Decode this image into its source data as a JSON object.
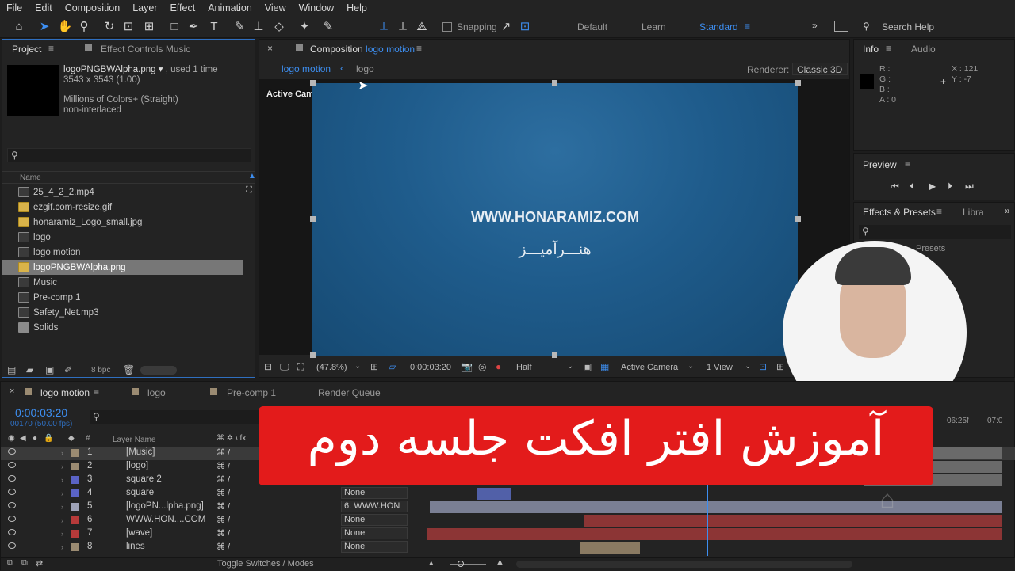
{
  "menu": [
    "File",
    "Edit",
    "Composition",
    "Layer",
    "Effect",
    "Animation",
    "View",
    "Window",
    "Help"
  ],
  "toolbar": {
    "snapping_label": "Snapping",
    "workspaces": [
      "Default",
      "Learn",
      "Standard"
    ],
    "search_placeholder": "Search Help"
  },
  "project": {
    "tab_project": "Project",
    "tab_effect_controls": "Effect Controls Music",
    "file_name": "logoPNGBWAlpha.png",
    "used": ", used 1 time",
    "dims": "3543 x 3543 (1.00)",
    "colors": "Millions of Colors+ (Straight)",
    "interlace": "non-interlaced",
    "col_name": "Name",
    "bpc": "8 bpc",
    "items": [
      {
        "name": "25_4_2_2.mp4",
        "icon": "video-icon"
      },
      {
        "name": "ezgif.com-resize.gif",
        "icon": "image-icon"
      },
      {
        "name": "honaramiz_Logo_small.jpg",
        "icon": "image-icon"
      },
      {
        "name": "logo",
        "icon": "composition-icon"
      },
      {
        "name": "logo motion",
        "icon": "composition-icon"
      },
      {
        "name": "logoPNGBWAlpha.png",
        "icon": "image-icon"
      },
      {
        "name": "Music",
        "icon": "composition-icon"
      },
      {
        "name": "Pre-comp 1",
        "icon": "composition-icon"
      },
      {
        "name": "Safety_Net.mp3",
        "icon": "audio-icon"
      },
      {
        "name": "Solids",
        "icon": "folder-icon"
      }
    ]
  },
  "composition": {
    "title_prefix": "Composition",
    "title_name": "logo motion",
    "crumb1": "logo motion",
    "crumb2": "logo",
    "renderer_label": "Renderer:",
    "renderer_value": "Classic 3D",
    "view_label": "Active Camera",
    "url_text": "WWW.HONARAMIZ.COM",
    "persian_text": "هنـــرآمیـــز",
    "zoom": "(47.8%)",
    "timecode": "0:00:03:20",
    "resolution": "Half",
    "camera": "Active Camera",
    "views": "1 View"
  },
  "info": {
    "tab_info": "Info",
    "tab_audio": "Audio",
    "r": "R :",
    "g": "G :",
    "b": "B :",
    "a": "A : 0",
    "x": "X : 121",
    "y": "Y : -7"
  },
  "preview": {
    "title": "Preview"
  },
  "effects": {
    "title": "Effects & Presets",
    "tab2": "Libra",
    "presets": "Presets"
  },
  "timeline": {
    "tabs": [
      "logo motion",
      "logo",
      "Pre-comp 1",
      "Render Queue"
    ],
    "timecode": "0:00:03:20",
    "frames": "00170 (50.00 fps)",
    "col_layer": "Layer Name",
    "ruler_1": "06:25f",
    "ruler_2": "07:0",
    "toggle": "Toggle Switches / Modes",
    "layers": [
      {
        "num": "1",
        "name": "[Music]",
        "parent": "",
        "color": "#9b8b72"
      },
      {
        "num": "2",
        "name": "[logo]",
        "parent": "",
        "color": "#9b8b72"
      },
      {
        "num": "3",
        "name": "square 2",
        "parent": "",
        "color": "#5a63c6"
      },
      {
        "num": "4",
        "name": "square",
        "parent": "None",
        "color": "#5a63c6"
      },
      {
        "num": "5",
        "name": "[logoPN...lpha.png]",
        "parent": "6. WWW.HON",
        "color": "#9fa3b8"
      },
      {
        "num": "6",
        "name": "WWW.HON....COM",
        "parent": "None",
        "color": "#b63a3a"
      },
      {
        "num": "7",
        "name": "[wave]",
        "parent": "None",
        "color": "#b63a3a"
      },
      {
        "num": "8",
        "name": "lines",
        "parent": "None",
        "color": "#9b8b72"
      }
    ]
  },
  "overlay": {
    "title": "آموزش افتر افکت جلسه دوم"
  },
  "colors": {
    "accent": "#3d8ef0",
    "banner": "#e31b1b",
    "comp_bg": "#1f5c8c"
  }
}
